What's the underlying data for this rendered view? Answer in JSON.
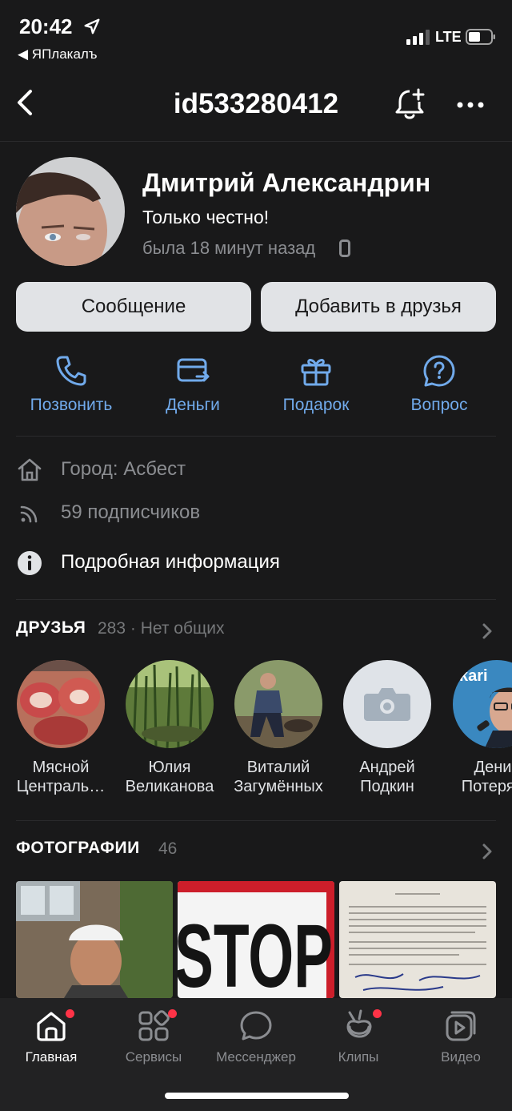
{
  "statusbar": {
    "time": "20:42",
    "back_app": "◀ ЯПлакалъ",
    "network": "LTE"
  },
  "header": {
    "title": "id533280412"
  },
  "profile": {
    "name": "Дмитрий Александрин",
    "status": "Только честно!",
    "last_seen": "была 18 минут назад"
  },
  "buttons": {
    "message": "Сообщение",
    "add_friend": "Добавить в друзья"
  },
  "actions": [
    {
      "label": "Позвонить",
      "icon": "phone-icon"
    },
    {
      "label": "Деньги",
      "icon": "money-transfer-icon"
    },
    {
      "label": "Подарок",
      "icon": "gift-icon"
    },
    {
      "label": "Вопрос",
      "icon": "question-icon"
    }
  ],
  "info": {
    "city": "Город: Асбест",
    "followers": "59 подписчиков",
    "details": "Подробная информация"
  },
  "friends": {
    "title": "ДРУЗЬЯ",
    "count": "283 · Нет общих",
    "items": [
      {
        "line1": "Мясной",
        "line2": "Централь…"
      },
      {
        "line1": "Юлия",
        "line2": "Великанова"
      },
      {
        "line1": "Виталий",
        "line2": "Загумённых"
      },
      {
        "line1": "Андрей",
        "line2": "Подкин"
      },
      {
        "line1": "Денис",
        "line2": "Потеряев"
      }
    ]
  },
  "photos": {
    "title": "ФОТОГРАФИИ",
    "count": "46",
    "stop_text": "STOP"
  },
  "tabbar": {
    "items": [
      {
        "label": "Главная",
        "icon": "home-icon",
        "active": true,
        "badge": true
      },
      {
        "label": "Сервисы",
        "icon": "services-icon",
        "active": false,
        "badge": true
      },
      {
        "label": "Мессенджер",
        "icon": "messenger-icon",
        "active": false,
        "badge": false
      },
      {
        "label": "Клипы",
        "icon": "clips-icon",
        "active": false,
        "badge": true
      },
      {
        "label": "Видео",
        "icon": "video-icon",
        "active": false,
        "badge": false
      }
    ]
  },
  "colors": {
    "background": "#19191a",
    "accent": "#71aaeb",
    "button": "#e1e3e6",
    "badge": "#ff3347",
    "muted": "#8b8d91"
  }
}
